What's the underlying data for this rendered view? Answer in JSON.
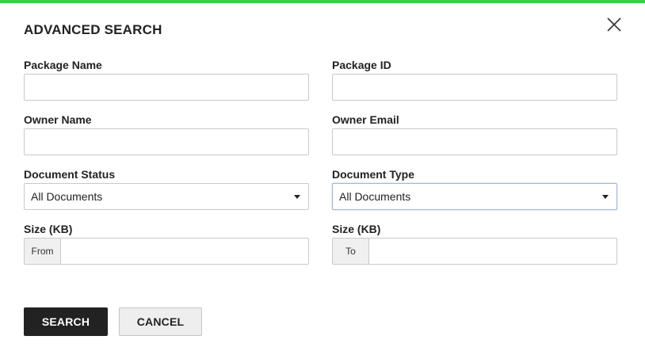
{
  "colors": {
    "accent_bar": "#3ecf3e",
    "primary_button": "#222222",
    "secondary_button": "#eeeeee"
  },
  "dialog": {
    "title": "ADVANCED SEARCH",
    "close_icon": "close-icon"
  },
  "fields": {
    "package_name": {
      "label": "Package Name",
      "value": "",
      "placeholder": ""
    },
    "package_id": {
      "label": "Package ID",
      "value": "",
      "placeholder": ""
    },
    "owner_name": {
      "label": "Owner Name",
      "value": "",
      "placeholder": ""
    },
    "owner_email": {
      "label": "Owner Email",
      "value": "",
      "placeholder": ""
    },
    "document_status": {
      "label": "Document Status",
      "selected": "All Documents"
    },
    "document_type": {
      "label": "Document Type",
      "selected": "All Documents"
    },
    "size_from": {
      "label": "Size (KB)",
      "addon": "From",
      "value": ""
    },
    "size_to": {
      "label": "Size (KB)",
      "addon": "To",
      "value": ""
    }
  },
  "buttons": {
    "search": "SEARCH",
    "cancel": "CANCEL"
  }
}
